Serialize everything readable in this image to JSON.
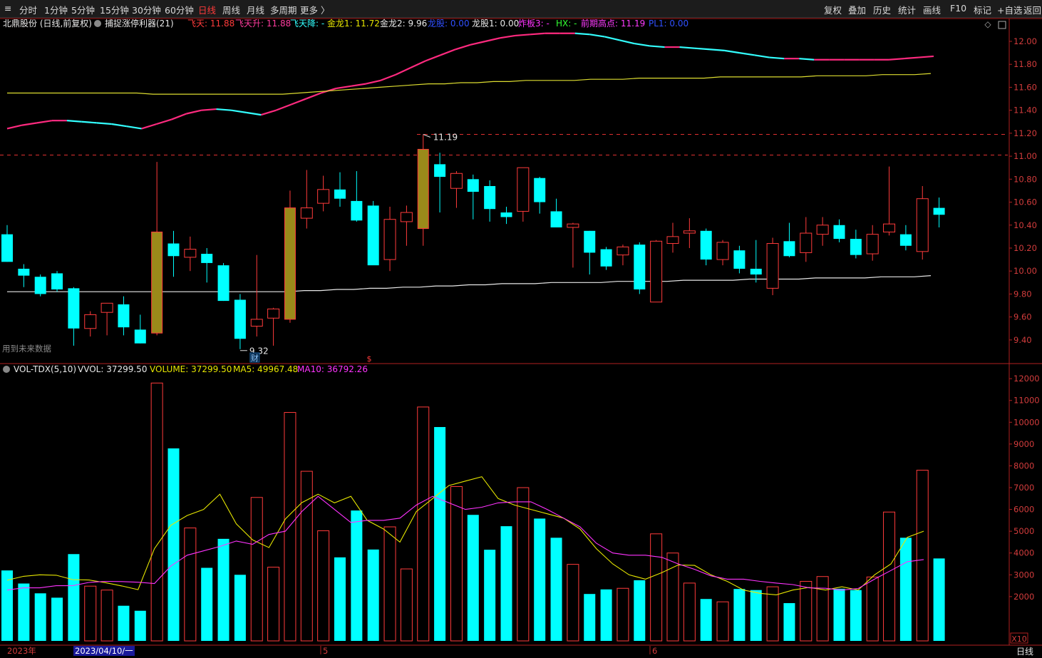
{
  "toolbar": {
    "left_corner": "≡",
    "periods": [
      "分时",
      "1分钟",
      "5分钟",
      "15分钟",
      "30分钟",
      "60分钟",
      "日线",
      "周线",
      "月线",
      "多周期",
      "更多 〉"
    ],
    "active_period": "日线",
    "right_items": [
      "复权",
      "叠加",
      "历史",
      "统计",
      "画线",
      "F10",
      "标记",
      "+自选",
      "返回"
    ]
  },
  "price_header": {
    "stock": "北鼎股份 (日线,前复权)",
    "indicator": "捕捉涨停利器(21)",
    "items": [
      {
        "label": "飞天: 11.88",
        "color": "#ff3b3b"
      },
      {
        "label": "飞天升: 11.88",
        "color": "#ff3c9e"
      },
      {
        "label": "飞天降: -",
        "color": "#33ffff"
      },
      {
        "label": "金龙1: 11.72",
        "color": "#e6e600"
      },
      {
        "label": "金龙2: 9.96",
        "color": "#e8e8e8"
      },
      {
        "label": "龙股: 0.00",
        "color": "#3050ff"
      },
      {
        "label": "龙股1: 0.00",
        "color": "#e8e8e8"
      },
      {
        "label": "炸板3: -",
        "color": "#ff33ff"
      },
      {
        "label": "HX: -",
        "color": "#33ff33"
      },
      {
        "label": "前期高点: 11.19",
        "color": "#ff3bff"
      },
      {
        "label": "PL1: 0.00",
        "color": "#3050ff"
      }
    ]
  },
  "volume_header": {
    "indicator": "VOL-TDX(5,10)",
    "items": [
      {
        "label": "VVOL: 37299.50",
        "color": "#e8e8e8"
      },
      {
        "label": "VOLUME: 37299.50",
        "color": "#e6e600"
      },
      {
        "label": "MA5: 49967.48",
        "color": "#e6e600"
      },
      {
        "label": "MA10: 36792.26",
        "color": "#ff33ff"
      }
    ]
  },
  "annotations": {
    "future_data": "用到未来数据",
    "high_label": "11.19",
    "low_label": "9.32",
    "fin_marker": "财",
    "dollar_marker": "$",
    "vol_unit": "X10",
    "bottom_right": "日线",
    "date_year": "2023年",
    "date_cursor": "2023/04/10/一",
    "month_5": "5",
    "month_6": "6"
  },
  "colors": {
    "up": "#ff3b3b",
    "down": "#00ffff",
    "highlight": "#9a8a1a",
    "axis": "#c83232"
  },
  "chart_data": [
    {
      "type": "candlestick",
      "ylim": [
        9.2,
        12.2
      ],
      "yticks": [
        9.4,
        9.6,
        9.8,
        10.0,
        10.2,
        10.4,
        10.6,
        10.8,
        11.0,
        11.2,
        11.4,
        11.6,
        11.8,
        12.0
      ],
      "candles": [
        {
          "o": 10.32,
          "h": 10.4,
          "l": 10.08,
          "c": 10.08
        },
        {
          "o": 10.02,
          "h": 10.06,
          "l": 9.86,
          "c": 9.96
        },
        {
          "o": 9.95,
          "h": 9.97,
          "l": 9.78,
          "c": 9.8
        },
        {
          "o": 9.98,
          "h": 10.0,
          "l": 9.82,
          "c": 9.84
        },
        {
          "o": 9.85,
          "h": 9.86,
          "l": 9.35,
          "c": 9.5
        },
        {
          "o": 9.5,
          "h": 9.65,
          "l": 9.43,
          "c": 9.62
        },
        {
          "o": 9.64,
          "h": 9.72,
          "l": 9.44,
          "c": 9.72
        },
        {
          "o": 9.71,
          "h": 9.78,
          "l": 9.44,
          "c": 9.51
        },
        {
          "o": 9.49,
          "h": 9.62,
          "l": 9.37,
          "c": 9.37
        },
        {
          "o": 9.46,
          "h": 10.95,
          "l": 9.44,
          "c": 10.34,
          "hl": true
        },
        {
          "o": 10.24,
          "h": 10.35,
          "l": 9.95,
          "c": 10.13
        },
        {
          "o": 10.12,
          "h": 10.3,
          "l": 10.0,
          "c": 10.19
        },
        {
          "o": 10.15,
          "h": 10.2,
          "l": 9.9,
          "c": 10.07
        },
        {
          "o": 10.05,
          "h": 10.07,
          "l": 9.74,
          "c": 9.74
        },
        {
          "o": 9.75,
          "h": 9.8,
          "l": 9.32,
          "c": 9.41
        },
        {
          "o": 9.52,
          "h": 10.14,
          "l": 9.43,
          "c": 9.58
        },
        {
          "o": 9.59,
          "h": 9.68,
          "l": 9.35,
          "c": 9.67
        },
        {
          "o": 9.58,
          "h": 10.7,
          "l": 9.55,
          "c": 10.55,
          "hl": true
        },
        {
          "o": 10.46,
          "h": 10.88,
          "l": 10.37,
          "c": 10.55
        },
        {
          "o": 10.59,
          "h": 10.83,
          "l": 10.52,
          "c": 10.71
        },
        {
          "o": 10.71,
          "h": 10.86,
          "l": 10.56,
          "c": 10.63
        },
        {
          "o": 10.61,
          "h": 10.87,
          "l": 10.43,
          "c": 10.44
        },
        {
          "o": 10.57,
          "h": 10.61,
          "l": 10.06,
          "c": 10.05
        },
        {
          "o": 10.1,
          "h": 10.56,
          "l": 10.0,
          "c": 10.45
        },
        {
          "o": 10.43,
          "h": 10.57,
          "l": 10.22,
          "c": 10.51
        },
        {
          "o": 10.37,
          "h": 11.19,
          "l": 10.22,
          "c": 11.06,
          "hl": true
        },
        {
          "o": 10.93,
          "h": 11.03,
          "l": 10.51,
          "c": 10.82
        },
        {
          "o": 10.72,
          "h": 10.87,
          "l": 10.55,
          "c": 10.85
        },
        {
          "o": 10.8,
          "h": 10.84,
          "l": 10.45,
          "c": 10.69
        },
        {
          "o": 10.74,
          "h": 10.79,
          "l": 10.43,
          "c": 10.54
        },
        {
          "o": 10.51,
          "h": 10.56,
          "l": 10.41,
          "c": 10.47
        },
        {
          "o": 10.52,
          "h": 10.9,
          "l": 10.43,
          "c": 10.9
        },
        {
          "o": 10.81,
          "h": 10.82,
          "l": 10.5,
          "c": 10.6
        },
        {
          "o": 10.52,
          "h": 10.63,
          "l": 10.38,
          "c": 10.38
        },
        {
          "o": 10.38,
          "h": 10.42,
          "l": 10.03,
          "c": 10.41
        },
        {
          "o": 10.35,
          "h": 10.35,
          "l": 9.97,
          "c": 10.16
        },
        {
          "o": 10.19,
          "h": 10.21,
          "l": 10.01,
          "c": 10.04
        },
        {
          "o": 10.14,
          "h": 10.23,
          "l": 10.05,
          "c": 10.21
        },
        {
          "o": 10.23,
          "h": 10.25,
          "l": 9.8,
          "c": 9.84
        },
        {
          "o": 9.73,
          "h": 10.27,
          "l": 9.73,
          "c": 10.26
        },
        {
          "o": 10.24,
          "h": 10.42,
          "l": 10.16,
          "c": 10.3
        },
        {
          "o": 10.33,
          "h": 10.46,
          "l": 10.2,
          "c": 10.35
        },
        {
          "o": 10.35,
          "h": 10.37,
          "l": 10.05,
          "c": 10.1
        },
        {
          "o": 10.1,
          "h": 10.27,
          "l": 10.05,
          "c": 10.25
        },
        {
          "o": 10.18,
          "h": 10.22,
          "l": 9.98,
          "c": 10.02
        },
        {
          "o": 10.02,
          "h": 10.27,
          "l": 9.9,
          "c": 9.97
        },
        {
          "o": 9.85,
          "h": 10.29,
          "l": 9.79,
          "c": 10.24
        },
        {
          "o": 10.26,
          "h": 10.42,
          "l": 10.12,
          "c": 10.13
        },
        {
          "o": 10.16,
          "h": 10.47,
          "l": 10.08,
          "c": 10.33
        },
        {
          "o": 10.32,
          "h": 10.47,
          "l": 10.22,
          "c": 10.4
        },
        {
          "o": 10.4,
          "h": 10.45,
          "l": 10.25,
          "c": 10.28
        },
        {
          "o": 10.28,
          "h": 10.36,
          "l": 10.11,
          "c": 10.14
        },
        {
          "o": 10.15,
          "h": 10.4,
          "l": 10.09,
          "c": 10.32
        },
        {
          "o": 10.34,
          "h": 10.91,
          "l": 10.31,
          "c": 10.41
        },
        {
          "o": 10.32,
          "h": 10.4,
          "l": 10.18,
          "c": 10.22
        },
        {
          "o": 10.17,
          "h": 10.74,
          "l": 10.1,
          "c": 10.63
        },
        {
          "o": 10.55,
          "h": 10.64,
          "l": 10.38,
          "c": 10.49
        }
      ],
      "lines": {
        "feitian": {
          "color_up": "#ff2a7f",
          "color_down": "#33ffff",
          "values": [
            11.24,
            11.27,
            11.29,
            11.31,
            11.31,
            11.3,
            11.29,
            11.28,
            11.26,
            11.24,
            11.28,
            11.32,
            11.37,
            11.4,
            11.41,
            11.4,
            11.38,
            11.36,
            11.4,
            11.45,
            11.5,
            11.55,
            11.59,
            11.61,
            11.63,
            11.66,
            11.71,
            11.77,
            11.83,
            11.88,
            11.93,
            11.97,
            12.0,
            12.03,
            12.05,
            12.06,
            12.07,
            12.07,
            12.07,
            12.06,
            12.04,
            12.01,
            11.98,
            11.96,
            11.95,
            11.95,
            11.94,
            11.93,
            11.92,
            11.9,
            11.88,
            11.86,
            11.85,
            11.85,
            11.84,
            11.84,
            11.84,
            11.84,
            11.84,
            11.84,
            11.85,
            11.86,
            11.87
          ]
        },
        "jinlong1": {
          "color": "#dddd30",
          "values": [
            11.55,
            11.55,
            11.55,
            11.55,
            11.55,
            11.55,
            11.55,
            11.55,
            11.55,
            11.54,
            11.54,
            11.54,
            11.54,
            11.54,
            11.54,
            11.54,
            11.54,
            11.54,
            11.55,
            11.56,
            11.57,
            11.58,
            11.59,
            11.6,
            11.61,
            11.62,
            11.63,
            11.63,
            11.64,
            11.64,
            11.65,
            11.65,
            11.66,
            11.66,
            11.66,
            11.66,
            11.67,
            11.67,
            11.67,
            11.68,
            11.68,
            11.68,
            11.68,
            11.68,
            11.69,
            11.69,
            11.69,
            11.69,
            11.69,
            11.69,
            11.7,
            11.7,
            11.7,
            11.7,
            11.71,
            11.71,
            11.71,
            11.72
          ]
        },
        "jinlong2": {
          "color": "#e8e8e8",
          "values": [
            9.82,
            9.82,
            9.82,
            9.82,
            9.82,
            9.82,
            9.82,
            9.82,
            9.82,
            9.82,
            9.82,
            9.82,
            9.82,
            9.82,
            9.82,
            9.82,
            9.82,
            9.82,
            9.83,
            9.83,
            9.84,
            9.84,
            9.85,
            9.85,
            9.86,
            9.86,
            9.87,
            9.87,
            9.88,
            9.88,
            9.89,
            9.89,
            9.89,
            9.9,
            9.9,
            9.9,
            9.9,
            9.91,
            9.91,
            9.91,
            9.91,
            9.92,
            9.92,
            9.92,
            9.92,
            9.93,
            9.93,
            9.93,
            9.93,
            9.94,
            9.94,
            9.94,
            9.94,
            9.95,
            9.95,
            9.95,
            9.96
          ]
        },
        "dashed_high": 11.19,
        "dashed_prev": 11.01
      }
    },
    {
      "type": "bar",
      "unit": "X10",
      "ylim": [
        0,
        12500
      ],
      "yticks": [
        2000,
        3000,
        4000,
        5000,
        6000,
        7000,
        8000,
        9000,
        10000,
        11000,
        12000
      ],
      "volumes": [
        3200,
        2600,
        2150,
        1950,
        3950,
        2480,
        2300,
        1580,
        1350,
        11800,
        8800,
        5150,
        3320,
        4650,
        3000,
        6550,
        3350,
        10450,
        7750,
        5020,
        3800,
        5950,
        4160,
        5200,
        3270,
        10700,
        9780,
        7050,
        5750,
        4150,
        5230,
        7000,
        5580,
        4700,
        3480,
        2120,
        2330,
        2380,
        2750,
        4880,
        4000,
        2620,
        1890,
        1760,
        2350,
        2300,
        2450,
        1700,
        2700,
        2920,
        2360,
        2300,
        2900,
        5880,
        4700,
        7800,
        3750
      ],
      "ma5": [
        2750,
        2930,
        3000,
        2980,
        2780,
        2760,
        2640,
        2490,
        2320,
        4200,
        5270,
        5720,
        6000,
        6700,
        5340,
        4600,
        4250,
        5560,
        6310,
        6700,
        6300,
        6600,
        5500,
        5100,
        4500,
        5900,
        6500,
        7100,
        7300,
        7500,
        6500,
        6200,
        6000,
        5800,
        5600,
        5100,
        4200,
        3500,
        3000,
        2800,
        3100,
        3450,
        3430,
        3000,
        2700,
        2300,
        2150,
        2080,
        2300,
        2420,
        2300,
        2450,
        2300,
        3000,
        3500,
        4720,
        5000
      ],
      "ma10": [
        2300,
        2400,
        2400,
        2500,
        2500,
        2650,
        2700,
        2690,
        2660,
        2600,
        3400,
        3900,
        4100,
        4300,
        4550,
        4400,
        4850,
        5000,
        5900,
        6600,
        6000,
        5400,
        5500,
        5500,
        5600,
        6200,
        6600,
        6300,
        6000,
        6100,
        6300,
        6350,
        6350,
        6000,
        5600,
        5200,
        4450,
        4000,
        3900,
        3900,
        3800,
        3500,
        3250,
        2950,
        2800,
        2800,
        2700,
        2620,
        2550,
        2400,
        2380,
        2300,
        2370,
        2800,
        3200,
        3600,
        3700
      ]
    }
  ]
}
